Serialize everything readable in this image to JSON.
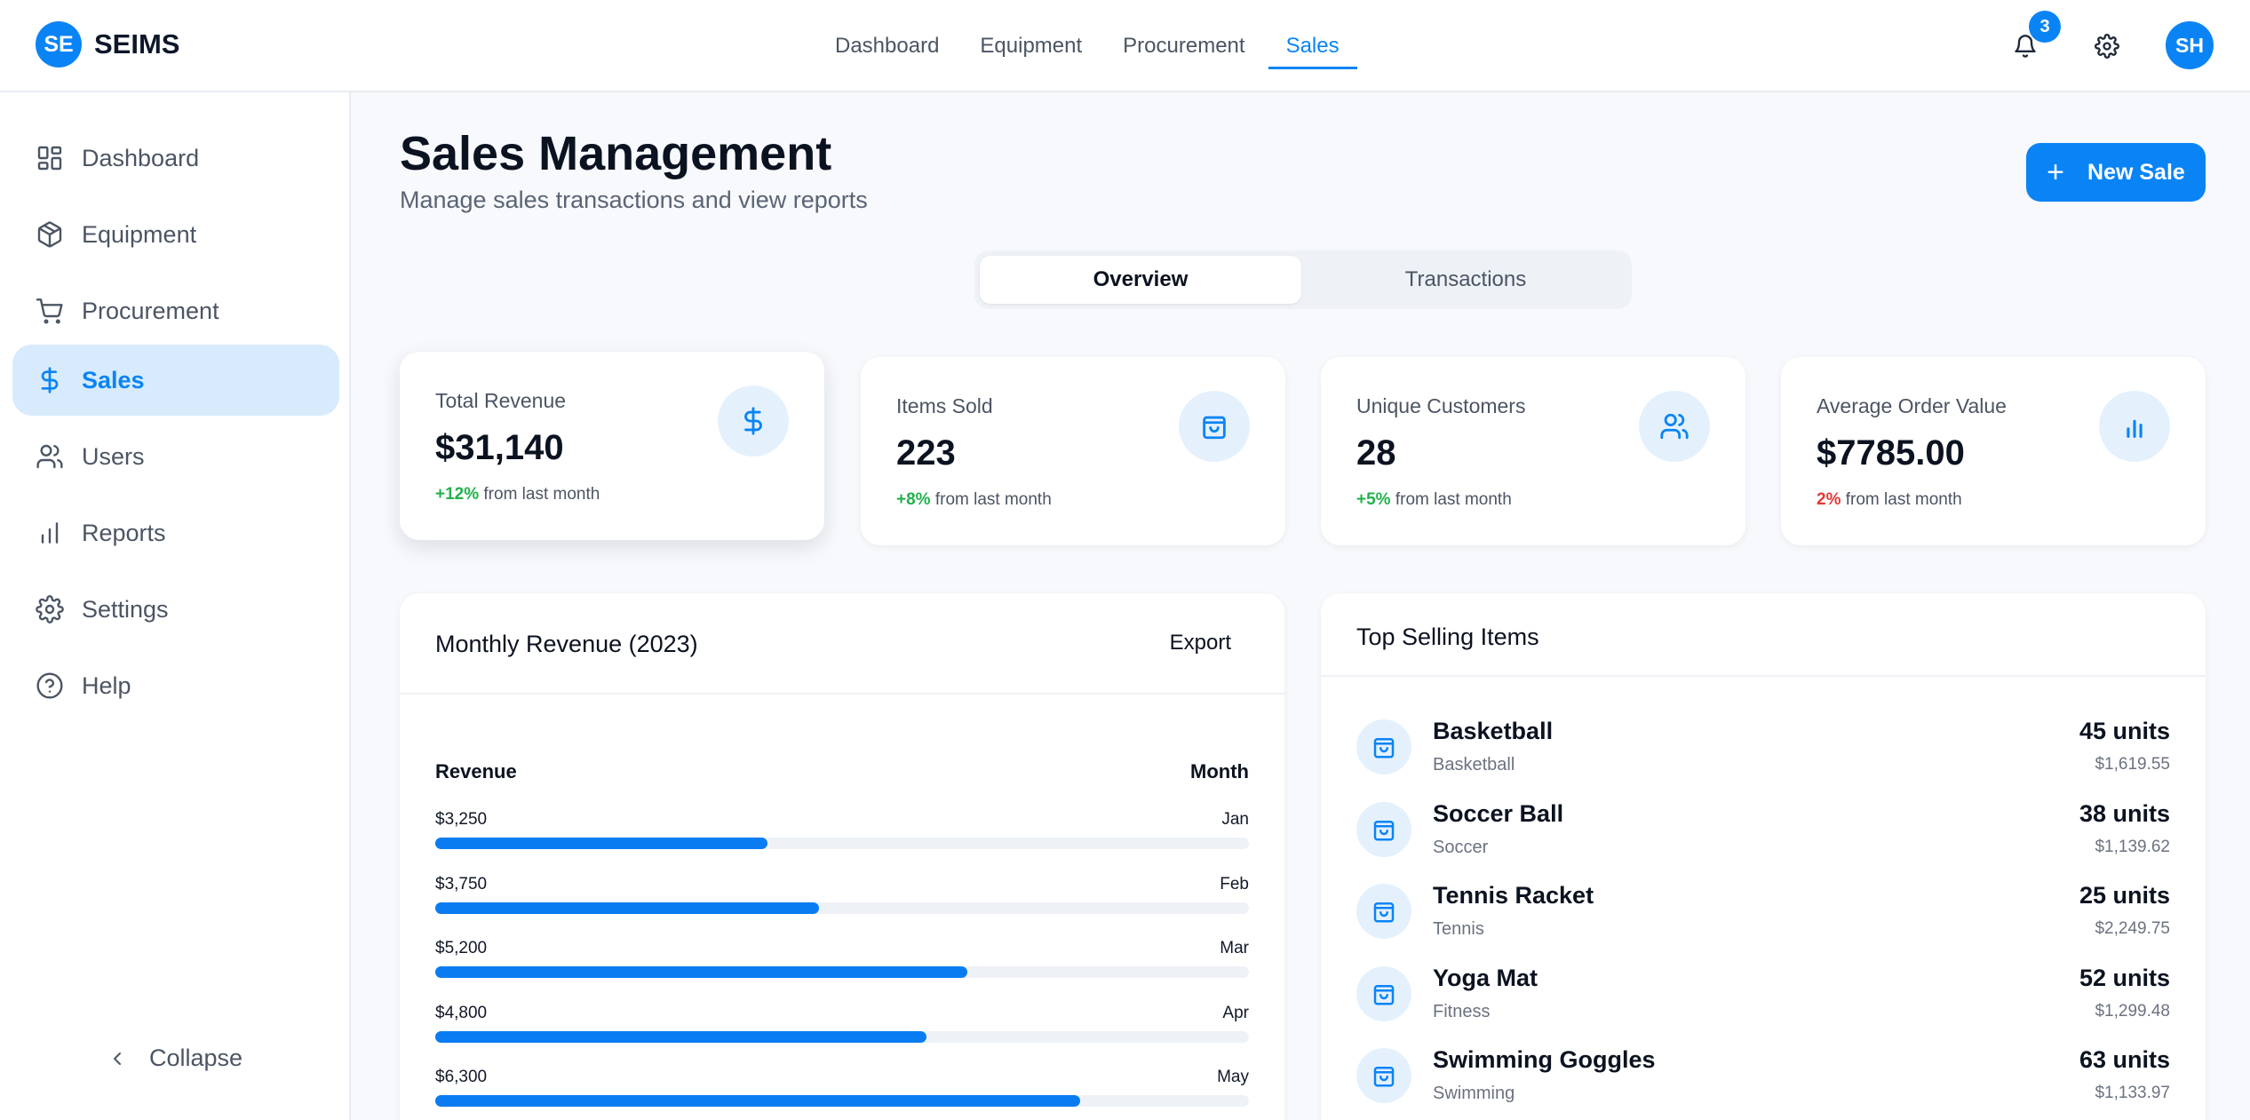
{
  "brand": {
    "logo": "SE",
    "name": "SEIMS"
  },
  "topnav": [
    {
      "label": "Dashboard"
    },
    {
      "label": "Equipment"
    },
    {
      "label": "Procurement"
    },
    {
      "label": "Sales",
      "active": true
    }
  ],
  "header": {
    "notification_count": "3",
    "avatar_initials": "SH",
    "icons": [
      "bell-icon",
      "gear-icon"
    ]
  },
  "sidebar": {
    "items": [
      {
        "label": "Dashboard",
        "icon": "grid-icon"
      },
      {
        "label": "Equipment",
        "icon": "package-icon"
      },
      {
        "label": "Procurement",
        "icon": "cart-icon"
      },
      {
        "label": "Sales",
        "icon": "dollar-icon",
        "active": true
      },
      {
        "label": "Users",
        "icon": "users-icon"
      },
      {
        "label": "Reports",
        "icon": "bar-chart-icon"
      },
      {
        "label": "Settings",
        "icon": "gear-icon"
      },
      {
        "label": "Help",
        "icon": "help-circle-icon"
      }
    ],
    "collapse_label": "Collapse"
  },
  "page": {
    "title": "Sales Management",
    "subtitle": "Manage sales transactions and view reports",
    "new_sale_label": "New Sale"
  },
  "tabs": [
    {
      "label": "Overview",
      "active": true
    },
    {
      "label": "Transactions"
    }
  ],
  "stats": [
    {
      "label": "Total Revenue",
      "value": "$31,140",
      "delta": "+12%",
      "delta_suffix": "from last month",
      "trend": "positive",
      "icon": "dollar-icon"
    },
    {
      "label": "Items Sold",
      "value": "223",
      "delta": "+8%",
      "delta_suffix": "from last month",
      "trend": "positive",
      "icon": "shopping-bag-icon"
    },
    {
      "label": "Unique Customers",
      "value": "28",
      "delta": "+5%",
      "delta_suffix": "from last month",
      "trend": "positive",
      "icon": "users-icon"
    },
    {
      "label": "Average Order Value",
      "value": "$7785.00",
      "delta": "2%",
      "delta_suffix": "from last month",
      "trend": "negative",
      "icon": "bar-chart-icon"
    }
  ],
  "monthly_revenue": {
    "title": "Monthly Revenue (2023)",
    "export_label": "Export",
    "col_revenue": "Revenue",
    "col_month": "Month",
    "max_value": 7950,
    "rows": [
      {
        "revenue_label": "$3,250",
        "month": "Jan",
        "value": 3250
      },
      {
        "revenue_label": "$3,750",
        "month": "Feb",
        "value": 3750
      },
      {
        "revenue_label": "$5,200",
        "month": "Mar",
        "value": 5200
      },
      {
        "revenue_label": "$4,800",
        "month": "Apr",
        "value": 4800
      },
      {
        "revenue_label": "$6,300",
        "month": "May",
        "value": 6300
      }
    ]
  },
  "top_selling": {
    "title": "Top Selling Items",
    "items": [
      {
        "name": "Basketball",
        "category": "Basketball",
        "units": "45 units",
        "revenue": "$1,619.55",
        "icon": "shopping-bag-icon"
      },
      {
        "name": "Soccer Ball",
        "category": "Soccer",
        "units": "38 units",
        "revenue": "$1,139.62",
        "icon": "shopping-bag-icon"
      },
      {
        "name": "Tennis Racket",
        "category": "Tennis",
        "units": "25 units",
        "revenue": "$2,249.75",
        "icon": "shopping-bag-icon"
      },
      {
        "name": "Yoga Mat",
        "category": "Fitness",
        "units": "52 units",
        "revenue": "$1,299.48",
        "icon": "shopping-bag-icon"
      },
      {
        "name": "Swimming Goggles",
        "category": "Swimming",
        "units": "63 units",
        "revenue": "$1,133.97",
        "icon": "shopping-bag-icon"
      }
    ]
  },
  "colors": {
    "accent": "#0a84f5",
    "positive": "#22b14c",
    "negative": "#e53935",
    "active_bg": "#d7ebfd"
  }
}
